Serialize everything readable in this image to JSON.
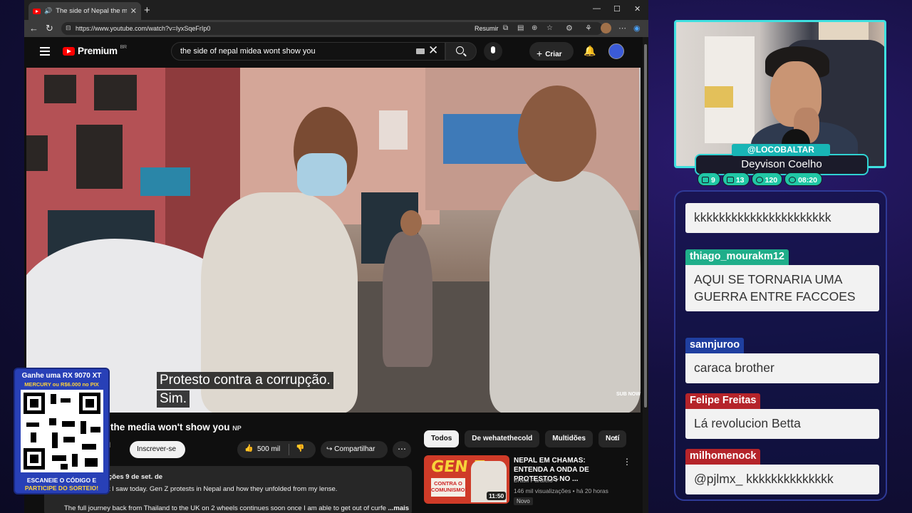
{
  "browser": {
    "tab_title": "The side of Nepal the media",
    "url": "https://www.youtube.com/watch?v=IyxSqeFrIp0",
    "resumir_label": "Resumir"
  },
  "youtube": {
    "logo_text": "Premium",
    "region": "BR",
    "search_query": "the side of nepal midea wont show you",
    "create_label": "Criar",
    "subtitle_line1": "Protesto contra a corrupção.",
    "subtitle_line2": "Sim.",
    "watermark": "SUB NOW",
    "video_title": "al the media won't show you",
    "video_title_flag": "NP",
    "channel_name_partial": "old",
    "subscribe_label": "Inscrever-se",
    "likes": "500 mil",
    "share_label": "Compartilhar",
    "description": {
      "meta": "ções  9 de set. de",
      "line1": "t I saw today. Gen Z protests in Nepal and how they unfolded from my lense.",
      "line2": "The full journey back from Thailand to the UK on 2 wheels continues soon once I am able to get out of curfe",
      "more": "...mais"
    },
    "chips": [
      "Todos",
      "De wehatethecold",
      "Multidões",
      "Notí"
    ],
    "recommended": {
      "title": "NEPAL EM CHAMAS: ENTENDA A ONDA DE PROTESTOS NO ...",
      "channel": "Brasil Paralelo",
      "views": "146 mil visualizações • há 20 horas",
      "badge": "Novo",
      "duration": "11:50",
      "thumb_text_1": "GEN Z",
      "thumb_text_2": "CONTRA O COMUNISMO!"
    }
  },
  "overlay_qr": {
    "line1": "Ganhe uma RX 9070 XT",
    "line2": "MERCURY ou R$6.000 no PIX",
    "bottom1": "ESCANEIE O CÓDIGO E",
    "bottom2": "PARTICIPE DO SORTEIO!"
  },
  "streamer": {
    "handle": "@LOCOBALTAR",
    "name": "Deyvison Coelho",
    "stats": [
      {
        "icon": "chat-icon",
        "value": "9"
      },
      {
        "icon": "youtube-icon",
        "value": "13"
      },
      {
        "icon": "coin-icon",
        "value": "120"
      },
      {
        "icon": "clock-icon",
        "value": "08:20"
      }
    ]
  },
  "chat": [
    {
      "user": "",
      "text": "kkkkkkkkkkkkkkkkkkkkkk",
      "color": "#1f3fa0"
    },
    {
      "user": "thiago_mourakm12",
      "text": "AQUI SE TORNARIA UMA GUERRA ENTRE FACCOES",
      "color": "#1fae8a"
    },
    {
      "user": "sannjuroo",
      "text": "caraca brother",
      "color": "#1f3fa0"
    },
    {
      "user": "Felipe Freitas",
      "text": "Lá revolucion Betta",
      "color": "#b5242a"
    },
    {
      "user": "milhomenock",
      "text": "@pjlmx_ kkkkkkkkkkkkkk",
      "color": "#b5242a"
    }
  ]
}
